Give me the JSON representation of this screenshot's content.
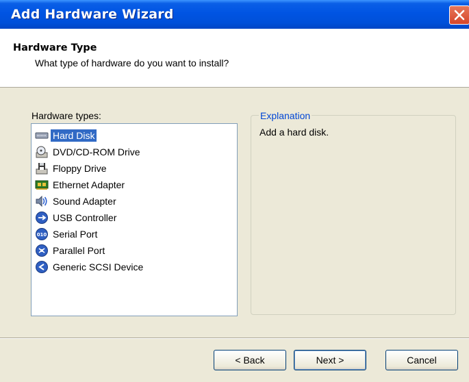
{
  "window": {
    "title": "Add Hardware Wizard"
  },
  "header": {
    "title": "Hardware Type",
    "subtitle": "What type of hardware do you want to install?"
  },
  "hardware_list": {
    "label": "Hardware types:",
    "items": [
      {
        "label": "Hard Disk",
        "icon": "hard-disk-icon",
        "selected": true
      },
      {
        "label": "DVD/CD-ROM Drive",
        "icon": "cd-drive-icon",
        "selected": false
      },
      {
        "label": "Floppy Drive",
        "icon": "floppy-drive-icon",
        "selected": false
      },
      {
        "label": "Ethernet Adapter",
        "icon": "ethernet-adapter-icon",
        "selected": false
      },
      {
        "label": "Sound Adapter",
        "icon": "sound-icon",
        "selected": false
      },
      {
        "label": "USB Controller",
        "icon": "usb-icon",
        "selected": false
      },
      {
        "label": "Serial Port",
        "icon": "serial-port-icon",
        "selected": false
      },
      {
        "label": "Parallel Port",
        "icon": "parallel-port-icon",
        "selected": false
      },
      {
        "label": "Generic SCSI Device",
        "icon": "scsi-icon",
        "selected": false
      }
    ]
  },
  "explanation": {
    "legend": "Explanation",
    "text": "Add a hard disk."
  },
  "buttons": {
    "back": "< Back",
    "next": "Next >",
    "cancel": "Cancel"
  },
  "colors": {
    "title_bar": "#0054e3",
    "selection": "#316ac5",
    "dialog_bg": "#ece9d8",
    "group_legend": "#0046d5"
  }
}
